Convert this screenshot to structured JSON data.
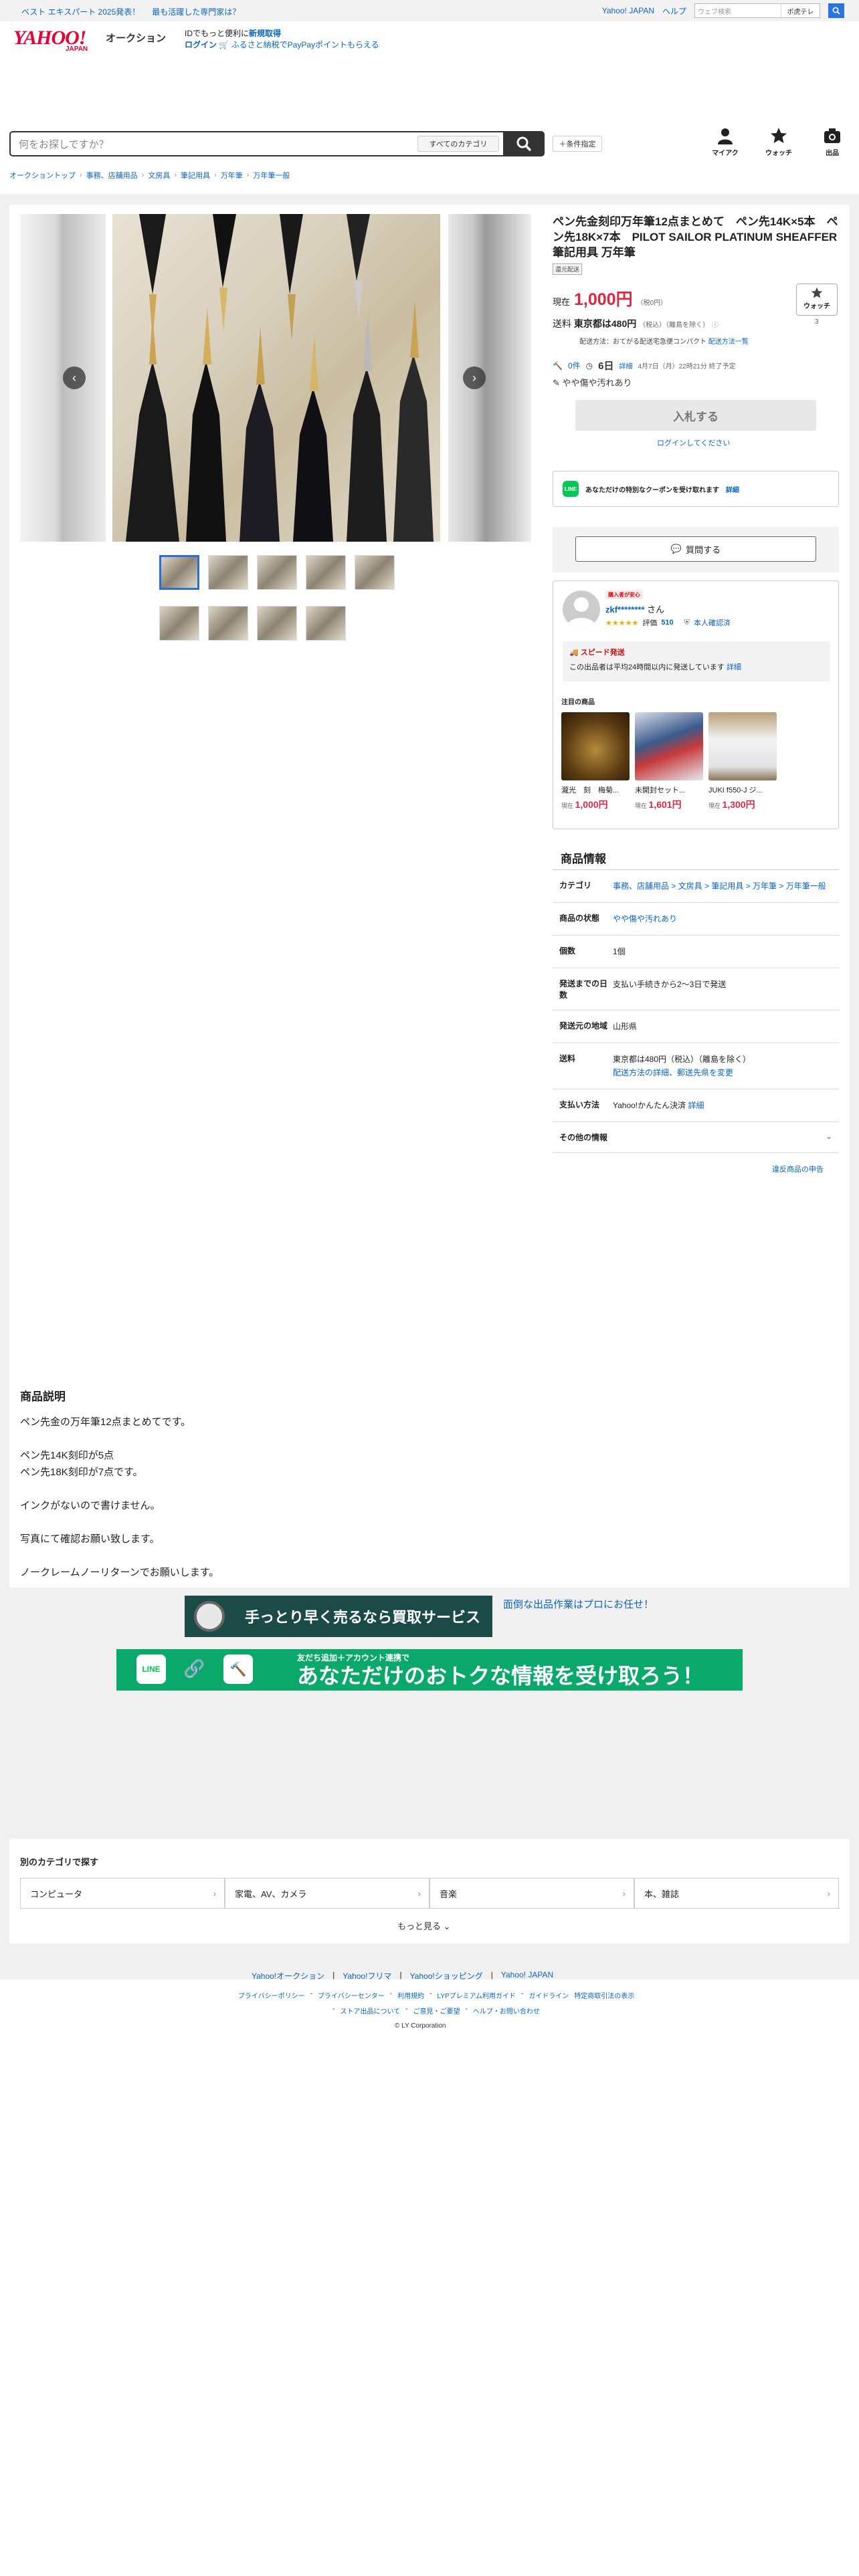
{
  "topbar": {
    "promo_a": "ベスト エキスパート 2025発表！",
    "promo_b": "最も活躍した専門家は？",
    "yahoo_japan": "Yahoo! JAPAN",
    "help": "ヘルプ",
    "search_placeholder": "ウェブ検索",
    "search_cart": "ボ虎テレ"
  },
  "header": {
    "logo_main": "YAHOO!",
    "logo_sub": "JAPAN",
    "logo_service": "オークション",
    "msg_line1": "IDでもっと便利に",
    "signup": "新規取得",
    "login": "ログイン",
    "msg_line2": "ふるさと納税でPayPayポイントもらえる"
  },
  "search": {
    "placeholder": "何をお探しですか？",
    "category": "すべてのカテゴリ",
    "conditions": "＋条件指定"
  },
  "nav": {
    "mypage": "マイアク",
    "watch": "ウォッチ",
    "sell": "出品"
  },
  "breadcrumbs": [
    "オークショントップ",
    "事務、店舗用品",
    "文房具",
    "筆記用具",
    "万年筆",
    "万年筆一般"
  ],
  "product": {
    "title": "ペン先金刻印万年筆12点まとめて　ペン先14K×5本　ペン先18K×7本　PILOT SAILOR PLATINUM SHEAFFER 筆記用具 万年筆",
    "tag": "還元配送",
    "price_label": "現在",
    "price": "1,000円",
    "tax": "（税0円）",
    "watch_label": "ウォッチ",
    "watch_count": "3",
    "ship_label": "送料",
    "ship_value": "東京都は480円",
    "ship_note": "（税込）（離島を除く）",
    "ship_method": "配送方法：おてがる配送宅急便コンパクト",
    "ship_link": "配送方法一覧",
    "bids": "0件",
    "time_left": "6日",
    "detail": "詳細",
    "end_time": "4月7日（月）22時21分 終了予定",
    "condition": "やや傷や汚れあり",
    "bid_button": "入札する",
    "login_msg": "ログインしてください",
    "coupon_text": "あなただけの特別なクーポンを受け取れます",
    "coupon_link": "詳細",
    "question": "質問する"
  },
  "seller": {
    "badge": "購入者が安心",
    "name": "zkf********",
    "san": "さん",
    "rating_label": "評価",
    "rating": "510",
    "verified": "本人確認済",
    "speed_title": "スピード発送",
    "speed_text": "この出品者は平均24時間以内に発送しています",
    "speed_link": "詳細",
    "featured": "注目の商品",
    "items": [
      {
        "title": "瀧光　刻　梅菊...",
        "label": "現在",
        "price": "1,000円"
      },
      {
        "title": "未開封セット...",
        "label": "現在",
        "price": "1,601円"
      },
      {
        "title": "JUKI f550-J ジ...",
        "label": "現在",
        "price": "1,300円"
      }
    ]
  },
  "info": {
    "heading": "商品情報",
    "rows": [
      {
        "k": "カテゴリ",
        "v": "事務、店舗用品 > 文房具 > 筆記用具 > 万年筆 > 万年筆一般"
      },
      {
        "k": "商品の状態",
        "v": "やや傷や汚れあり"
      },
      {
        "k": "個数",
        "v": "1個"
      },
      {
        "k": "発送までの日数",
        "v": "支払い手続きから2〜3日で発送"
      },
      {
        "k": "発送元の地域",
        "v": "山形県"
      },
      {
        "k": "送料",
        "v": "東京都は480円（税込）（離島を除く）"
      },
      {
        "k": "支払い方法",
        "v": "Yahoo!かんたん決済"
      },
      {
        "k": "その他の情報",
        "v": ""
      }
    ],
    "ship_detail_link": "配送方法の詳細、郵送先県を変更",
    "pay_detail": "詳細",
    "report": "違反商品の申告"
  },
  "description": {
    "heading": "商品説明",
    "lines": [
      "ペン先金の万年筆12点まとめてです。",
      "",
      "ペン先14K刻印が5点",
      "ペン先18K刻印が7点です。",
      "",
      "インクがないので書けません。",
      "",
      "写真にて確認お願い致します。",
      "",
      "ノークレームノーリターンでお願いします。"
    ]
  },
  "banners": {
    "b1": "手っとり早く売るなら買取サービス",
    "b1_alt": "面倒な出品作業はプロにお任せ！",
    "b2_small": "友だち追加＋アカウント連携で",
    "b2": "あなただけのおトクな情報を受け取ろう！"
  },
  "categories": {
    "heading": "別のカテゴリで探す",
    "items": [
      "コンピュータ",
      "家電、AV、カメラ",
      "音楽",
      "本、雑誌"
    ],
    "more": "もっと見る"
  },
  "footer": {
    "links1": [
      "Yahoo!オークション",
      "Yahoo!フリマ",
      "Yahoo!ショッピング",
      "Yahoo! JAPAN"
    ],
    "links2": [
      "プライバシーポリシー",
      "プライバシーセンター",
      "利用規約",
      "LYPプレミアム利用ガイド",
      "ガイドライン",
      "特定商取引法の表示",
      "ストア出品について",
      "ご意見・ご要望",
      "ヘルプ・お問い合わせ"
    ],
    "copyright": "© LY Corporation"
  }
}
